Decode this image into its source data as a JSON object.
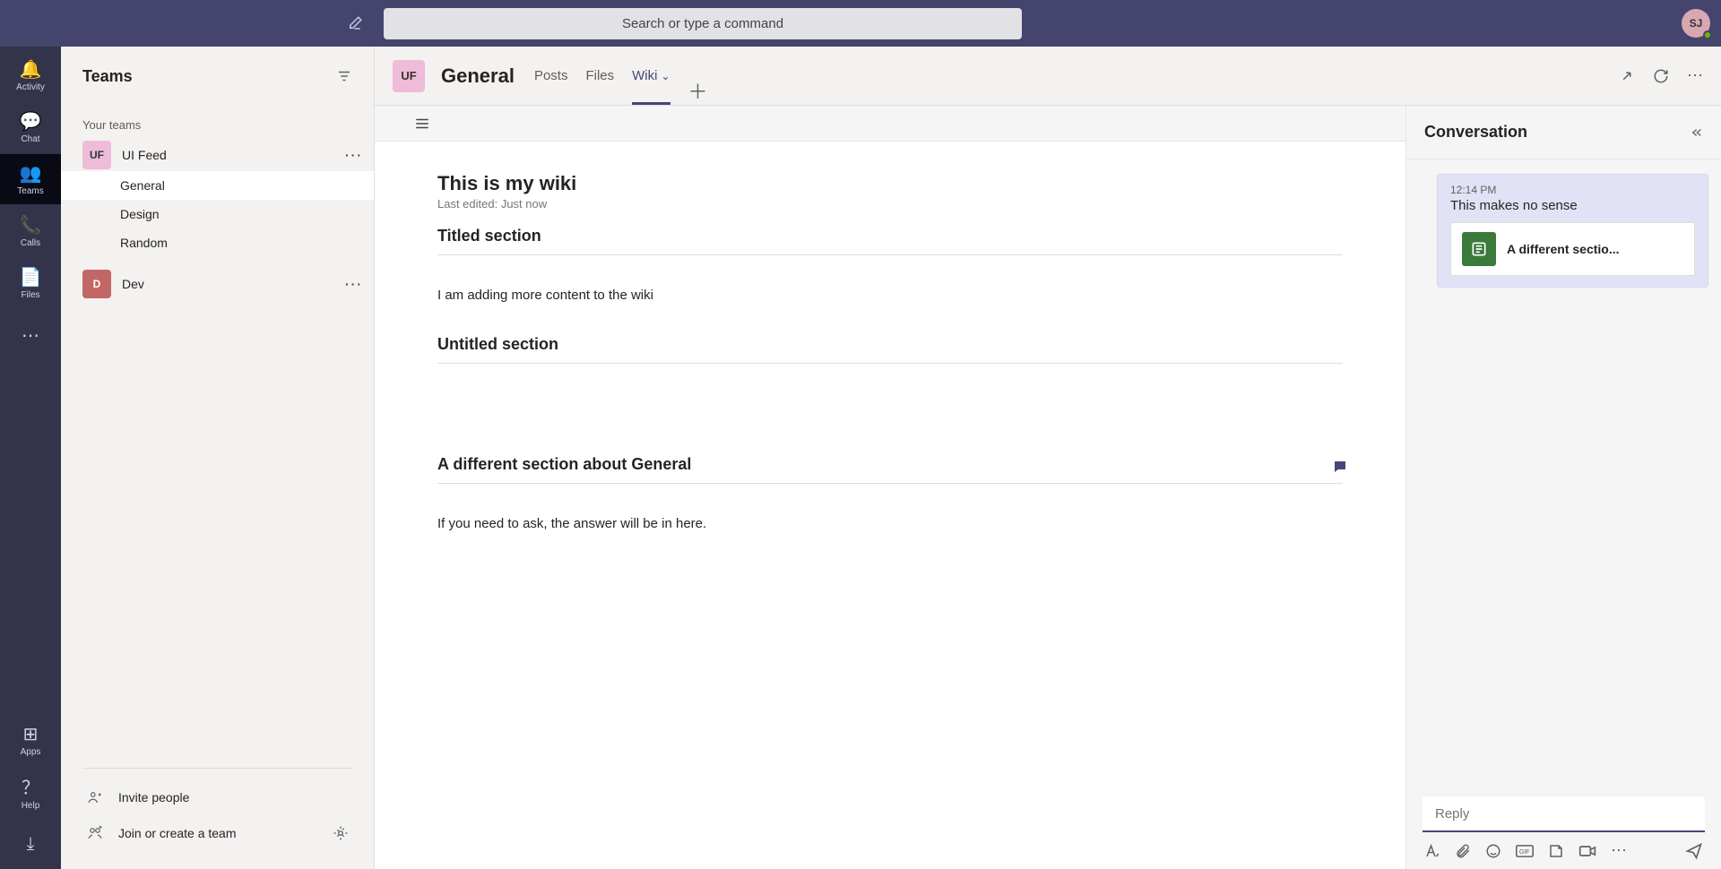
{
  "colors": {
    "bg_dark": "#44446C",
    "rail": "#33344A",
    "accent": "#464775"
  },
  "header": {
    "search_placeholder": "Search or type a command",
    "user_initials": "SJ"
  },
  "rail": {
    "items": [
      {
        "id": "activity",
        "label": "Activity"
      },
      {
        "id": "chat",
        "label": "Chat"
      },
      {
        "id": "teams",
        "label": "Teams",
        "selected": true
      },
      {
        "id": "calls",
        "label": "Calls"
      },
      {
        "id": "files",
        "label": "Files"
      }
    ],
    "more_label": "",
    "apps_label": "Apps",
    "help_label": "Help"
  },
  "teams_pane": {
    "title": "Teams",
    "section_label": "Your teams",
    "teams": [
      {
        "id": "uifeed",
        "initials": "UF",
        "name": "UI Feed"
      },
      {
        "id": "dev",
        "initials": "D",
        "name": "Dev"
      }
    ],
    "channels_uifeed": [
      {
        "name": "General",
        "selected": true
      },
      {
        "name": "Design"
      },
      {
        "name": "Random"
      }
    ],
    "footer_invite": "Invite people",
    "footer_join": "Join or create a team"
  },
  "channel_header": {
    "avatar": "UF",
    "title": "General",
    "tabs": [
      {
        "label": "Posts"
      },
      {
        "label": "Files"
      },
      {
        "label": "Wiki",
        "active": true
      }
    ]
  },
  "wiki": {
    "title": "This is my wiki",
    "last_edited": "Last edited: Just now",
    "sections": [
      {
        "title": "Titled section",
        "body": "I am adding more content to the wiki"
      },
      {
        "title": "Untitled section",
        "body": ""
      },
      {
        "title": "A different section about General",
        "body": "If you need to ask, the answer will be in here.",
        "has_conversation": true
      }
    ]
  },
  "conversation": {
    "title": "Conversation",
    "messages": [
      {
        "time": "12:14 PM",
        "text": "This makes no sense",
        "ref_label": "A different sectio..."
      }
    ],
    "reply_placeholder": "Reply"
  }
}
